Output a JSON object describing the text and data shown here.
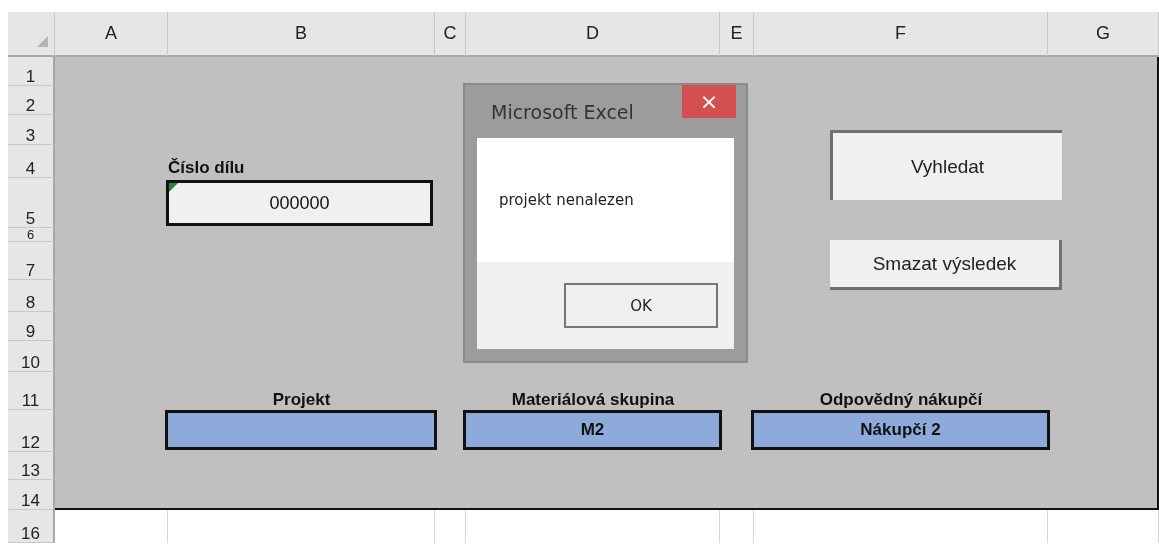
{
  "columns": [
    "A",
    "B",
    "C",
    "D",
    "E",
    "F",
    "G"
  ],
  "rows": [
    "1",
    "2",
    "3",
    "4",
    "5",
    "6",
    "7",
    "8",
    "9",
    "10",
    "11",
    "12",
    "13",
    "14",
    "16"
  ],
  "part_number": {
    "label": "Číslo dílu",
    "value": "000000",
    "flagged": true
  },
  "results": [
    {
      "label": "Projekt"
    },
    {
      "label": "Materiálová skupina",
      "value": "M2"
    },
    {
      "label": "Odpovědný nákupčí",
      "value": "Nákupčí 2"
    }
  ],
  "buttons": [
    "Vyhledat",
    "Smazat výsledek"
  ],
  "dialog": {
    "title": "Microsoft Excel",
    "close": "×",
    "message": "projekt nenalezen",
    "button": "OK"
  }
}
